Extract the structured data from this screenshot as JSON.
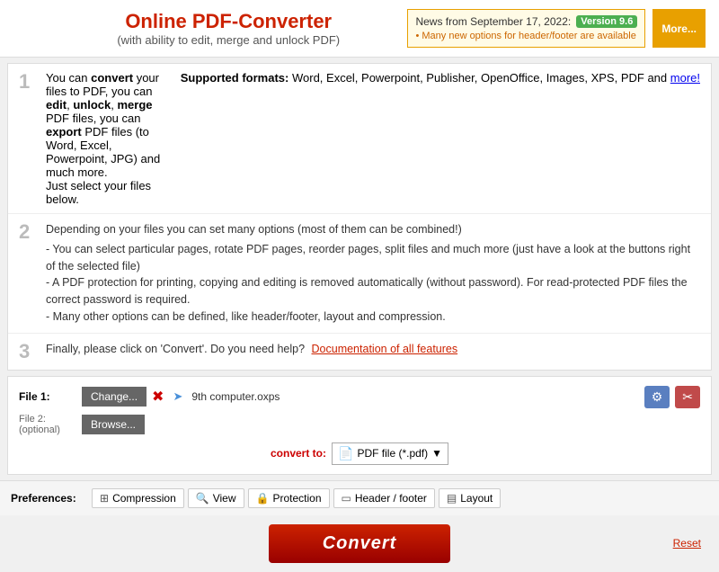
{
  "header": {
    "title": "Online PDF-Converter",
    "subtitle": "(with ability to edit, merge and unlock PDF)",
    "news_date": "News from September 17, 2022:",
    "version": "Version 9.6",
    "news_bullet": "Many new options for header/footer are available",
    "more_label": "More..."
  },
  "steps": [
    {
      "number": "1",
      "text_html": "You can <b>convert</b> your files to PDF, you can <b>edit</b>, <b>unlock</b>, <b>merge</b> PDF files, you can <b>export</b> PDF files (to Word, Excel, Powerpoint, JPG) and much more.<br>Just select your files below.",
      "formats_label": "Supported formats:",
      "formats_text": "Word, Excel, Powerpoint, Publisher, OpenOffice, Images, XPS, PDF and",
      "formats_link": "more!"
    },
    {
      "number": "2",
      "title": "Depending on your files you can set many options (most of them can be combined!)",
      "bullets": [
        "- You can select particular pages, rotate PDF pages, reorder pages, split files and much more (just have a look at the buttons right of the selected file)",
        "- A PDF protection for printing, copying and editing is removed automatically (without password). For read-protected PDF files the correct password is required.",
        "- Many other options can be defined, like header/footer, layout and compression."
      ]
    },
    {
      "number": "3",
      "text": "Finally, please click on 'Convert'. Do you need help?",
      "link_text": "Documentation of all features"
    }
  ],
  "file_section": {
    "file1_label": "File 1:",
    "file2_label": "File 2:",
    "file2_sublabel": "(optional)",
    "change_btn": "Change...",
    "browse_btn": "Browse...",
    "file1_name": "9th computer.oxps",
    "convert_to_label": "convert to:",
    "pdf_option": "PDF file (*.pdf)"
  },
  "preferences": {
    "label": "Preferences:",
    "tabs": [
      {
        "icon": "⊞",
        "label": "Compression"
      },
      {
        "icon": "🔍",
        "label": "View"
      },
      {
        "icon": "🔒",
        "label": "Protection"
      },
      {
        "icon": "▭",
        "label": "Header / footer"
      },
      {
        "icon": "▤",
        "label": "Layout"
      }
    ]
  },
  "convert_btn": "Convert",
  "reset_label": "Reset"
}
